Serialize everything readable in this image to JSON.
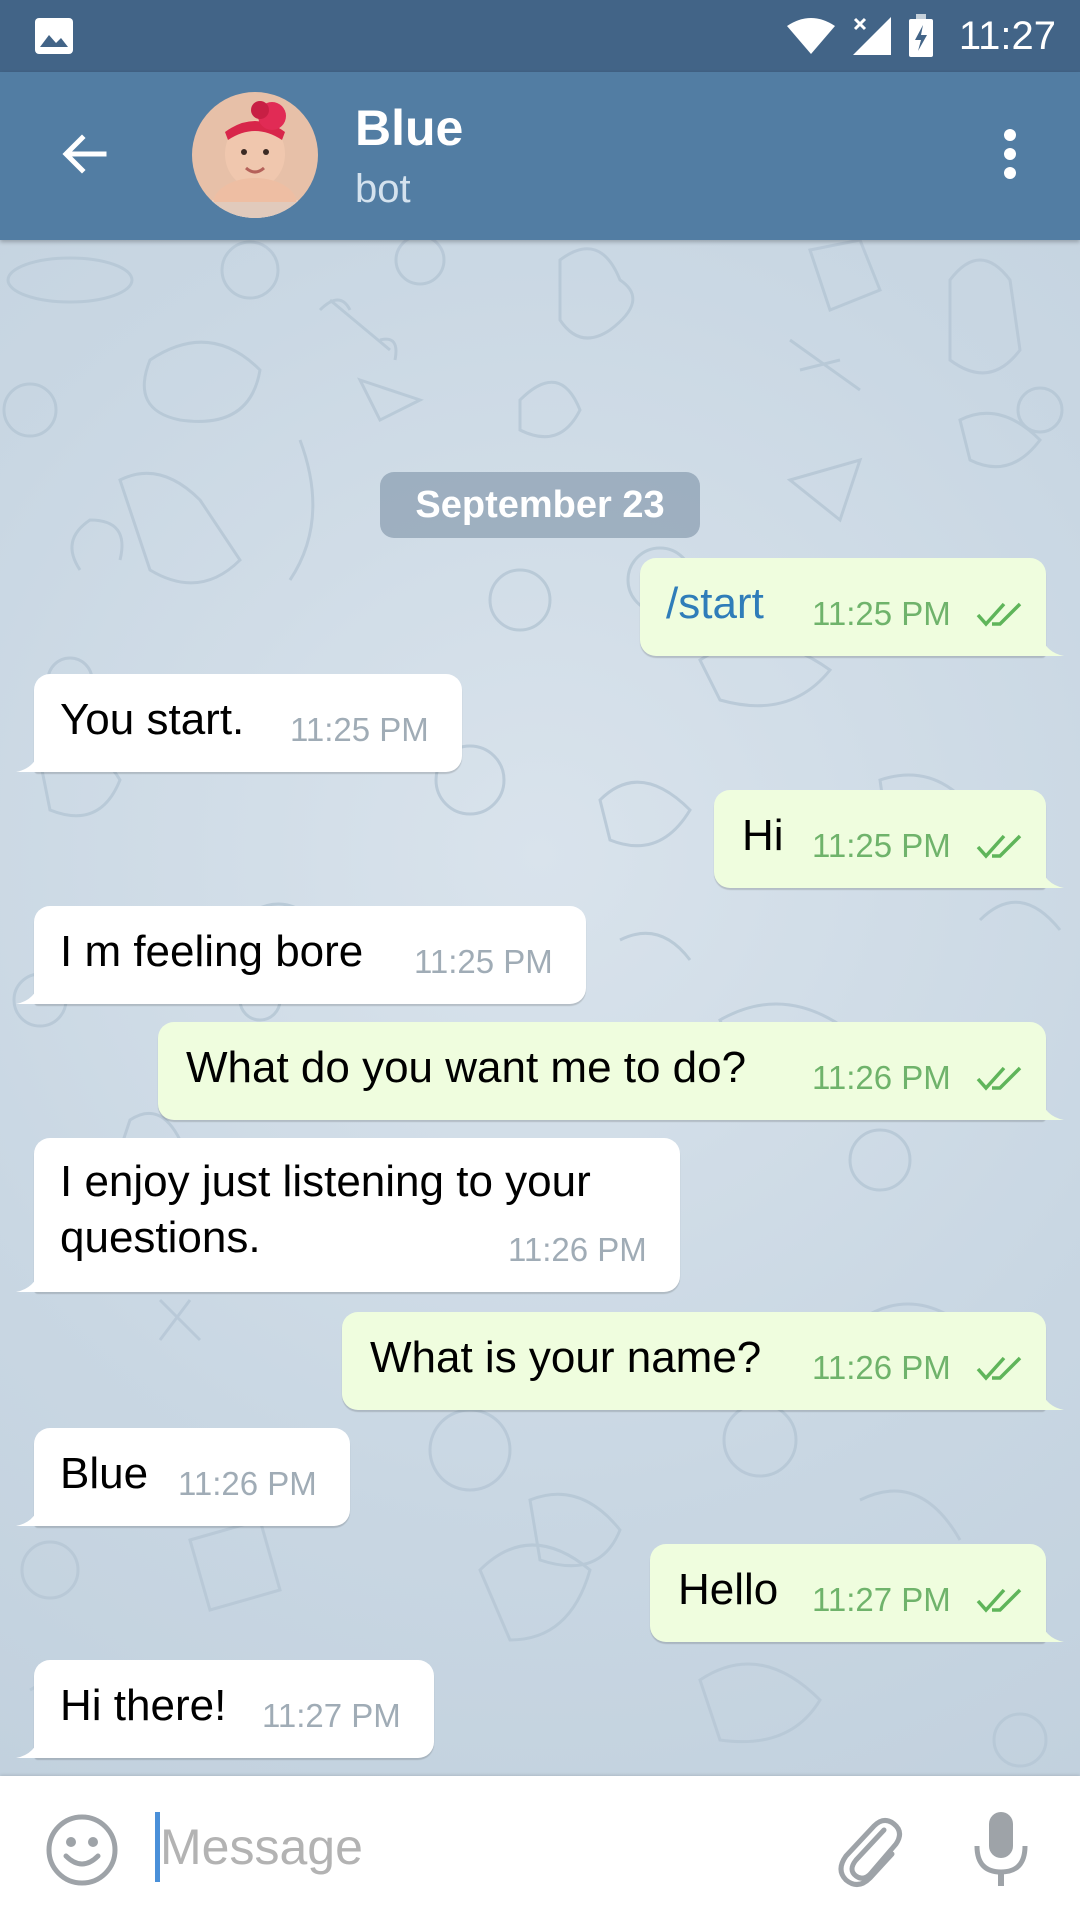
{
  "status_bar": {
    "time": "11:27",
    "left_icon": "image-notification-icon",
    "icons": [
      "wifi-icon",
      "cellular-signal-icon",
      "battery-charging-icon"
    ]
  },
  "header": {
    "title": "Blue",
    "subtitle": "bot",
    "back_icon": "arrow-back-icon",
    "menu_icon": "more-vert-icon"
  },
  "chat": {
    "date_label": "September 23",
    "messages": [
      {
        "direction": "out",
        "text": "/start",
        "time": "11:25 PM",
        "status": "read"
      },
      {
        "direction": "in",
        "text": "You start.",
        "time": "11:25 PM"
      },
      {
        "direction": "out",
        "text": "Hi",
        "time": "11:25 PM",
        "status": "read"
      },
      {
        "direction": "in",
        "text": "I m feeling bore",
        "time": "11:25 PM"
      },
      {
        "direction": "out",
        "text": "What do you want me to do?",
        "time": "11:26 PM",
        "status": "read"
      },
      {
        "direction": "in",
        "text_line1": "I enjoy just listening to your",
        "text_line2": "questions.",
        "time": "11:26 PM"
      },
      {
        "direction": "out",
        "text": "What is your name?",
        "time": "11:26 PM",
        "status": "read"
      },
      {
        "direction": "in",
        "text": "Blue",
        "time": "11:26 PM"
      },
      {
        "direction": "out",
        "text": "Hello",
        "time": "11:27 PM",
        "status": "read"
      },
      {
        "direction": "in",
        "text": "Hi there!",
        "time": "11:27 PM"
      }
    ]
  },
  "input_bar": {
    "placeholder": "Message",
    "value": "",
    "emoji_icon": "emoji-smile-icon",
    "attach_icon": "paperclip-icon",
    "mic_icon": "microphone-icon"
  },
  "colors": {
    "status_bar": "#426487",
    "app_bar": "#527da3",
    "outgoing_bubble": "#effdde",
    "incoming_bubble": "#ffffff",
    "outgoing_time": "#6fb36b",
    "command_link": "#2f7db9"
  }
}
